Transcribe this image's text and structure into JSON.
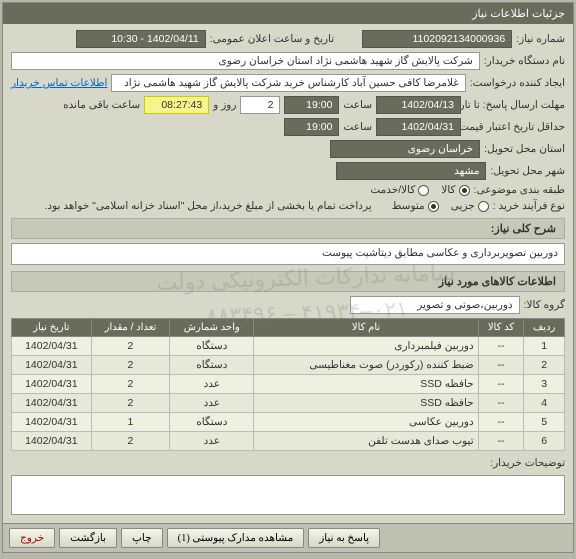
{
  "window_title": "جزئیات اطلاعات نیاز",
  "fields": {
    "need_no_label": "شماره نیاز:",
    "need_no": "1102092134000936",
    "announce_label": "تاریخ و ساعت اعلان عمومی:",
    "announce_val": "1402/04/11 - 10:30",
    "buyer_label": "نام دستگاه خریدار:",
    "buyer_val": "شرکت پالایش گاز شهید هاشمی نژاد   استان خراسان رضوی",
    "creator_label": "ایجاد کننده درخواست:",
    "creator_val": "غلامرضا کافی حسین آباد کارشناس خرید  شرکت پالایش گاز شهید هاشمی نژاد",
    "contact_link": "اطلاعات تماس خریدار",
    "deadline_label": "مهلت ارسال پاسخ: تا تاریخ:",
    "deadline_date": "1402/04/13",
    "hour_label": "ساعت",
    "deadline_time": "19:00",
    "dayword_label": "روز و",
    "days": "2",
    "countdown": "08:27:43",
    "remaining_label": "ساعت باقی مانده",
    "validity_label": "حداقل تاریخ اعتبار قیمت: تا تاریخ:",
    "validity_date": "1402/04/31",
    "validity_time": "19:00",
    "province_label": "استان محل تحویل:",
    "province_val": "خراسان رضوی",
    "city_label": "شهر محل تحویل:",
    "city_val": "مشهد",
    "category_label": "طبقه بندی موضوعی:",
    "cat_goods": "کالا",
    "cat_service": "کالا/خدمت",
    "process_label": "نوع فرآیند خرید :",
    "proc_micro": "جزیی",
    "proc_medium": "متوسط",
    "payment_note": "پرداخت تمام یا بخشی از مبلغ خرید،از محل \"اسناد خزانه اسلامی\" خواهد بود."
  },
  "summary_head": "شرح کلی نیاز:",
  "summary_text": "دوربین تصویربرداری و عکاسی مطابق دیتاشیت پیوست",
  "items_head": "اطلاعات کالاهای مورد نیاز",
  "group_label": "گروه کالا:",
  "group_val": "دوربین،صوتی و تصویر",
  "cols": {
    "row": "ردیف",
    "code": "کد کالا",
    "name": "نام کالا",
    "unit": "واحد شمارش",
    "qty": "تعداد / مقدار",
    "date": "تاریخ نیاز"
  },
  "rows": [
    {
      "n": "1",
      "code": "--",
      "name": "دوربین فیلمبرداری",
      "unit": "دستگاه",
      "qty": "2",
      "date": "1402/04/31"
    },
    {
      "n": "2",
      "code": "--",
      "name": "ضبط کننده (رکوردر) صوت مغناطیسی",
      "unit": "دستگاه",
      "qty": "2",
      "date": "1402/04/31"
    },
    {
      "n": "3",
      "code": "--",
      "name": "حافظه SSD",
      "unit": "عدد",
      "qty": "2",
      "date": "1402/04/31"
    },
    {
      "n": "4",
      "code": "--",
      "name": "حافظه SSD",
      "unit": "عدد",
      "qty": "2",
      "date": "1402/04/31"
    },
    {
      "n": "5",
      "code": "--",
      "name": "دوربین عکاسی",
      "unit": "دستگاه",
      "qty": "1",
      "date": "1402/04/31"
    },
    {
      "n": "6",
      "code": "--",
      "name": "تیوب صدای هدست تلفن",
      "unit": "عدد",
      "qty": "2",
      "date": "1402/04/31"
    }
  ],
  "buyer_notes_label": "توضیحات خریدار:",
  "footer": {
    "exit": "خروج",
    "save": "بازگشت",
    "print": "چاپ",
    "attach": "مشاهده مدارک پیوستی (1)",
    "reply": "پاسخ به نیاز"
  },
  "watermark": {
    "l1": "سامانه تدارکات الکترونیکی دولت",
    "l2": "۰۲۱–۴۱۹۳۴ – ۸۸۳۴۹۶"
  }
}
